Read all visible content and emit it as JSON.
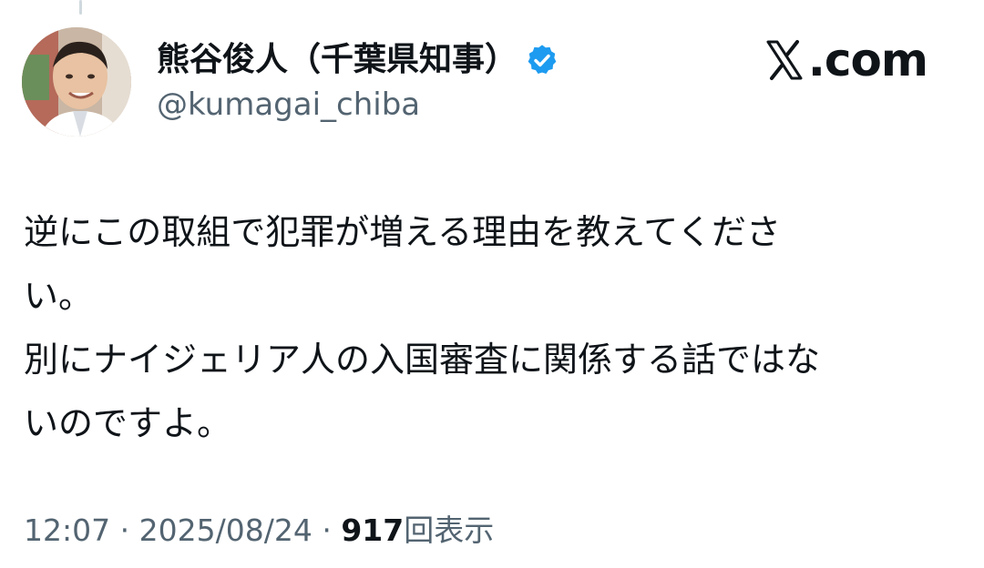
{
  "author": {
    "display_name": "熊谷俊人（千葉県知事）",
    "handle": "@kumagai_chiba",
    "verified_icon": "verified-badge-icon",
    "avatar_icon": "profile-photo"
  },
  "brand": {
    "label": ".com",
    "icon": "x-logo-icon"
  },
  "tweet": {
    "lines": [
      "逆にこの取組で犯罪が増える理由を教えてくださ",
      "い。",
      "別にナイジェリア人の入国審査に関係する話ではな",
      "いのですよ。"
    ]
  },
  "meta": {
    "time": "12:07",
    "separator": "·",
    "date": "2025/08/24",
    "views_count": "917",
    "views_label": "回表示"
  },
  "colors": {
    "text": "#0f1419",
    "secondary": "#536471",
    "verified_blue": "#1d9bf0"
  }
}
